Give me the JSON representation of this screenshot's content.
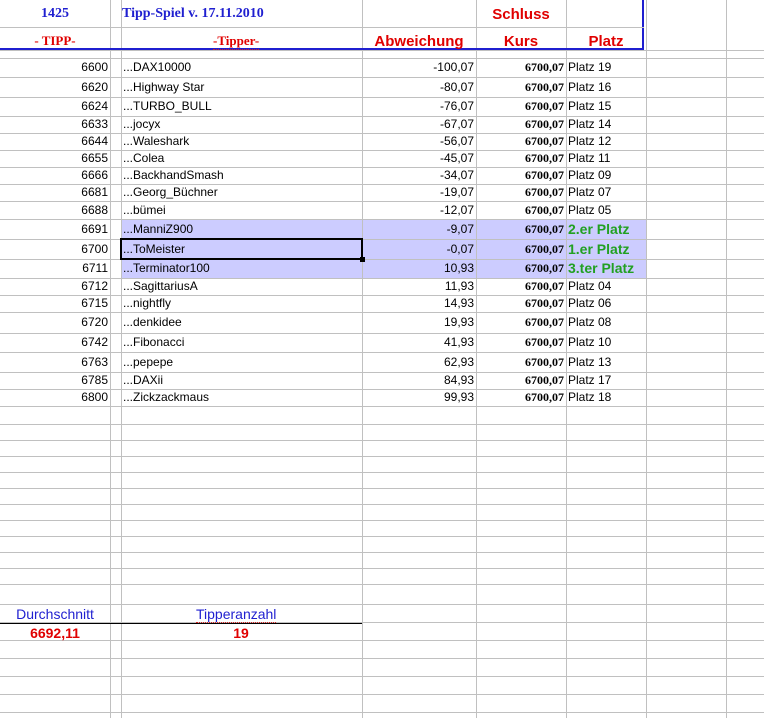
{
  "header": {
    "id_number": "1425",
    "title": "Tipp-Spiel v. 17.11.2010",
    "schluss": "Schluss",
    "col_tipp": "- TIPP-",
    "col_tipper": "-Tipper-",
    "col_abweichung": "Abweichung",
    "col_kurs": "Kurs",
    "col_platz": "Platz"
  },
  "colors": {
    "header_blue": "#1f1fd0",
    "header_red": "#e00000",
    "winner_green": "#22a022",
    "highlight": "#ccccff"
  },
  "rows": [
    {
      "tipp": "6600",
      "tipper": "...DAX10000",
      "abweichung": "-100,07",
      "kurs": "6700,07",
      "platz": "Platz 19"
    },
    {
      "tipp": "6620",
      "tipper": "...Highway Star",
      "abweichung": "-80,07",
      "kurs": "6700,07",
      "platz": "Platz 16"
    },
    {
      "tipp": "6624",
      "tipper": "...TURBO_BULL",
      "abweichung": "-76,07",
      "kurs": "6700,07",
      "platz": "Platz 15"
    },
    {
      "tipp": "6633",
      "tipper": "...jocyx",
      "abweichung": "-67,07",
      "kurs": "6700,07",
      "platz": "Platz 14"
    },
    {
      "tipp": "6644",
      "tipper": "...Waleshark",
      "abweichung": "-56,07",
      "kurs": "6700,07",
      "platz": "Platz 12"
    },
    {
      "tipp": "6655",
      "tipper": "...Colea",
      "abweichung": "-45,07",
      "kurs": "6700,07",
      "platz": "Platz 11"
    },
    {
      "tipp": "6666",
      "tipper": "...BackhandSmash",
      "abweichung": "-34,07",
      "kurs": "6700,07",
      "platz": "Platz 09"
    },
    {
      "tipp": "6681",
      "tipper": "...Georg_Büchner",
      "abweichung": "-19,07",
      "kurs": "6700,07",
      "platz": "Platz 07"
    },
    {
      "tipp": "6688",
      "tipper": "...bümei",
      "abweichung": "-12,07",
      "kurs": "6700,07",
      "platz": "Platz 05"
    },
    {
      "tipp": "6691",
      "tipper": "...ManniZ900",
      "abweichung": "-9,07",
      "kurs": "6700,07",
      "platz": "2.er Platz",
      "winner": true
    },
    {
      "tipp": "6700",
      "tipper": "...ToMeister",
      "abweichung": "-0,07",
      "kurs": "6700,07",
      "platz": "1.er Platz",
      "winner": true,
      "selected": true
    },
    {
      "tipp": "6711",
      "tipper": "...Terminator100",
      "abweichung": "10,93",
      "kurs": "6700,07",
      "platz": "3.ter Platz",
      "winner": true
    },
    {
      "tipp": "6712",
      "tipper": "...SagittariusA",
      "abweichung": "11,93",
      "kurs": "6700,07",
      "platz": "Platz 04"
    },
    {
      "tipp": "6715",
      "tipper": "...nightfly",
      "abweichung": "14,93",
      "kurs": "6700,07",
      "platz": "Platz 06"
    },
    {
      "tipp": "6720",
      "tipper": "...denkidee",
      "abweichung": "19,93",
      "kurs": "6700,07",
      "platz": "Platz 08"
    },
    {
      "tipp": "6742",
      "tipper": "...Fibonacci",
      "abweichung": "41,93",
      "kurs": "6700,07",
      "platz": "Platz 10"
    },
    {
      "tipp": "6763",
      "tipper": "...pepepe",
      "abweichung": "62,93",
      "kurs": "6700,07",
      "platz": "Platz 13"
    },
    {
      "tipp": "6785",
      "tipper": "...DAXii",
      "abweichung": "84,93",
      "kurs": "6700,07",
      "platz": "Platz 17"
    },
    {
      "tipp": "6800",
      "tipper": "...Zickzackmaus",
      "abweichung": "99,93",
      "kurs": "6700,07",
      "platz": "Platz 18"
    }
  ],
  "summary": {
    "durchschnitt_label": "Durchschnitt",
    "durchschnitt_value": "6692,11",
    "tipperanzahl_label": "Tipperanzahl",
    "tipperanzahl_value": "19"
  }
}
